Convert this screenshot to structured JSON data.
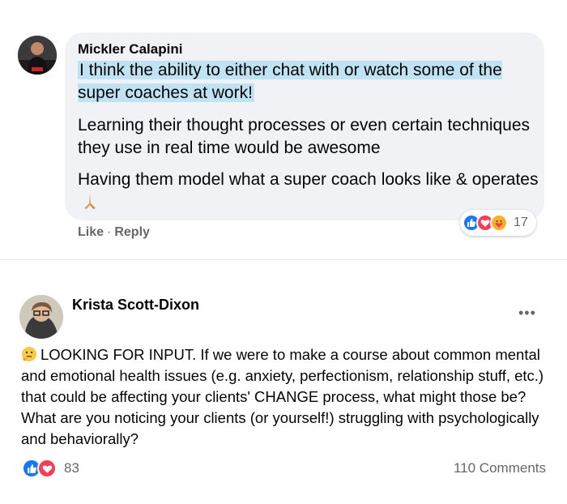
{
  "comment": {
    "author": "Mickler Calapini",
    "paragraph1": "I think the ability to either chat with or watch some of the super coaches at work!",
    "paragraph2": "Learning their thought processes or even certain techniques they use in real time would be awesome",
    "paragraph3": "Having them model what a super coach looks like & operates",
    "emoji": "praying-hands",
    "like_label": "Like",
    "separator": "·",
    "reply_label": "Reply",
    "reaction_count": "17",
    "reactions": [
      "like",
      "love",
      "care"
    ]
  },
  "post": {
    "author": "Krista Scott-Dixon",
    "more_label": "•••",
    "emoji": "thinking-face",
    "text": "LOOKING FOR INPUT. If we were to make a course about common mental and emotional health issues (e.g. anxiety, perfectionism, relationship stuff, etc.) that could be affecting your clients' CHANGE process, what might those be? What are you noticing your clients (or yourself!) struggling with psychologically and behaviorally?",
    "reaction_count": "83",
    "reactions": [
      "like",
      "love"
    ],
    "comments_label": "110 Comments"
  },
  "colors": {
    "highlight": "#bfe3f2",
    "bubble": "#f0f2f5",
    "like_blue": "#1877f2",
    "love_red": "#f33e58",
    "care_yellow": "#f7b125",
    "secondary_text": "#65676b"
  }
}
